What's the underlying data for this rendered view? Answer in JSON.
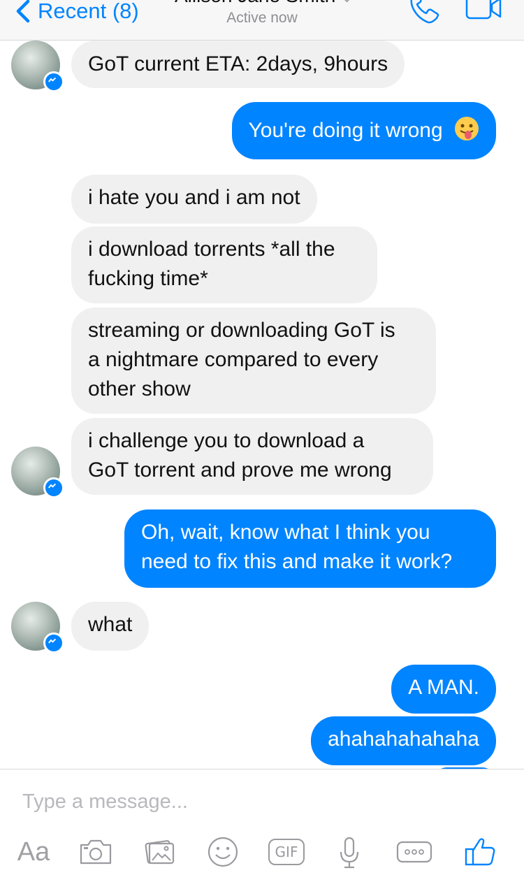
{
  "header": {
    "back_label": "Recent (8)",
    "contact_name": "Allison Jane Smith",
    "status": "Active now",
    "icons": [
      "chevron-left-icon",
      "phone-icon",
      "video-camera-icon"
    ]
  },
  "messages": [
    {
      "direction": "in",
      "text": "GoT current ETA: 2days, 9hours"
    },
    {
      "direction": "out",
      "text": "You're doing it wrong",
      "emoji": "tongue-out-emoji"
    },
    {
      "direction": "in",
      "text": "i hate you and i am not"
    },
    {
      "direction": "in",
      "lines": [
        "i download torrents *all the",
        "fucking time*"
      ]
    },
    {
      "direction": "in",
      "lines": [
        "streaming or downloading GoT is",
        "a nightmare compared to every",
        "other show"
      ]
    },
    {
      "direction": "in",
      "lines": [
        "i challenge you to download a",
        "GoT torrent and prove me wrong"
      ]
    },
    {
      "direction": "out",
      "lines": [
        "Oh, wait, know what I think you",
        "need to fix this and make it work?"
      ]
    },
    {
      "direction": "in",
      "text": "what"
    },
    {
      "direction": "out",
      "text": "A MAN."
    },
    {
      "direction": "out",
      "text": "ahahahahahaha"
    }
  ],
  "composer": {
    "placeholder": "Type a message...",
    "aa_label": "Aa",
    "gif_label": "GIF",
    "tools": [
      "text-format-icon",
      "camera-icon",
      "photo-gallery-icon",
      "emoji-icon",
      "gif-icon",
      "microphone-icon",
      "more-icon",
      "thumbs-up-icon"
    ]
  },
  "colors": {
    "accent": "#0084ff",
    "incoming_bubble": "#f1f0f0",
    "header_bg": "#f7f7f8",
    "muted_text": "#8e8e93"
  }
}
